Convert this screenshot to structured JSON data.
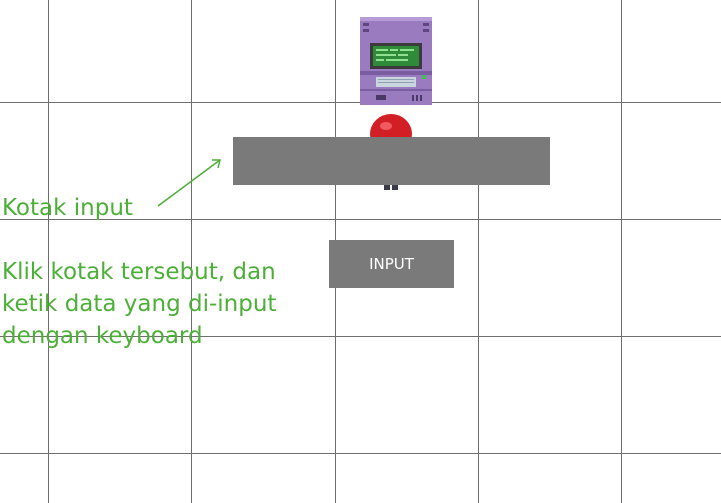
{
  "input_box": {
    "value": "",
    "placeholder": ""
  },
  "input_button": {
    "label": "INPUT"
  },
  "annotation": {
    "title": "Kotak input",
    "lines": [
      "Klik kotak tersebut, dan",
      "ketik data yang di-input",
      "dengan keyboard"
    ]
  },
  "sprites": {
    "computer": "retro-computer-icon",
    "character": "red-hooded-character-sprite"
  },
  "colors": {
    "hint_text": "#4caf37",
    "input_bg": "#7a7a7a",
    "grid": "#6e6e6e",
    "computer_body": "#9b7bc0",
    "screen": "#2f8a3a",
    "character": "#d21f26"
  }
}
